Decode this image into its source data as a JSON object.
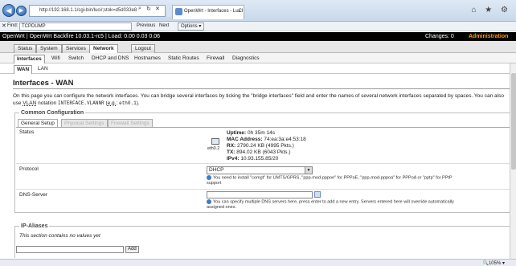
{
  "browser": {
    "url": "http://192.168.1.1/cgi-bin/luci/;stok=d5d033e8",
    "tab_title": "OpenWrt - Interfaces - LuCI",
    "tab_close": "×",
    "chrome_icons": "⌂ ★ ⚙"
  },
  "find": {
    "label": "Find:",
    "value": "TCPDUMP",
    "previous": "Previous",
    "next": "Next",
    "options": "Options ▾"
  },
  "luci": {
    "host_info": "OpenWrt | OpenWrt Backfire 10.03.1-rc5 | Load: 0.00 0.03 0.06",
    "changes": "Changes: 0",
    "admin": "Administration"
  },
  "menu": [
    "Status",
    "System",
    "Services",
    "Network",
    "Logout"
  ],
  "menu_active": "Network",
  "submenu": [
    "Interfaces",
    "Wifi",
    "Switch",
    "DHCP and DNS",
    "Hostnames",
    "Static Routes",
    "Firewall",
    "Diagnostics"
  ],
  "iface_tabs": [
    "WAN",
    "LAN"
  ],
  "page": {
    "title": "Interfaces - WAN",
    "intro_1": "On this page you can configure the network interfaces. You can bridge several interfaces by ticking the \"bridge interfaces\" field and enter the names of several network interfaces separated by spaces. You",
    "intro_2a": "can also use ",
    "intro_vlan": "VLAN",
    "intro_2b": " notation ",
    "intro_code": "INTERFACE.VLANNR",
    "intro_2c": " (",
    "intro_eg": "e.g.",
    "intro_2d": ": ",
    "intro_code2": "eth0.1",
    "intro_2e": ")."
  },
  "common": {
    "legend": "Common Configuration",
    "tabs": [
      "General Setup",
      "Physical Settings",
      "Firewall Settings"
    ],
    "status_label": "Status",
    "eth_name": "eth0.2",
    "uptime_label": "Uptime:",
    "uptime": "0h 35m 14s",
    "mac_label": "MAC Address:",
    "mac": "74:ea:3a:e4:53:18",
    "rx_label": "RX:",
    "rx": "2790.24 KB (4995 Pkts.)",
    "tx_label": "TX:",
    "tx": "894.02 KB (6043 Pkts.)",
    "ipv4_label": "IPv4:",
    "ipv4": "10.93.155.85/20",
    "protocol_label": "Protocol",
    "protocol_value": "DHCP",
    "protocol_hint_1": "You need to install \"comgt\" for UMTS/GPRS, \"ppp-mod-pppoe\" for PPPoE, \"ppp-mod-pppoa\" for PPPoA or \"pptp\" for PPtP",
    "protocol_hint_2": "support",
    "dns_label": "DNS-Server",
    "dns_hint_1": "You can specify multiple DNS servers here, press enter to add a new entry. Servers entered here will override automatically",
    "dns_hint_2": "assigned ones."
  },
  "aliases": {
    "legend": "IP-Aliases",
    "empty": "This section contains no values yet",
    "add": "Add"
  },
  "statusbar": {
    "zoom": "🔍105% ▾"
  }
}
